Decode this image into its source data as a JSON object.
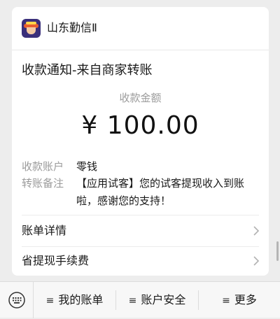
{
  "merchant": {
    "name": "山东勤信Ⅱ"
  },
  "notice": {
    "title": "收款通知-来自商家转账",
    "amount_label": "收款金额",
    "amount_value": "¥ 100.00"
  },
  "details": [
    {
      "label": "收款账户",
      "value": "零钱"
    },
    {
      "label": "转账备注",
      "value": "【应用试客】您的试客提现收入到账啦，感谢您的支持！"
    }
  ],
  "links": [
    {
      "label": "账单详情"
    },
    {
      "label": "省提现手续费"
    }
  ],
  "bottom_menu": {
    "keyboard_icon": "keyboard-icon",
    "tabs": [
      {
        "icon": "≡",
        "label": "我的账单"
      },
      {
        "icon": "≡",
        "label": "账户安全"
      },
      {
        "icon": "≡",
        "label": "更多"
      }
    ]
  }
}
